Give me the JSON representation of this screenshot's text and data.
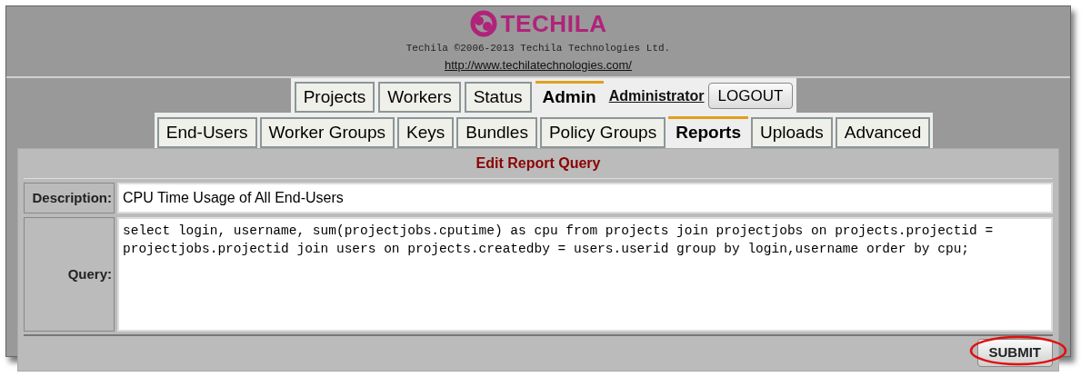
{
  "header": {
    "logo_text": "TECHILA",
    "copyright": "Techila ©2006-2013 Techila Technologies Ltd.",
    "link": "http://www.techilatechnologies.com/"
  },
  "main_tabs": [
    {
      "label": "Projects",
      "selected": false
    },
    {
      "label": "Workers",
      "selected": false
    },
    {
      "label": "Status",
      "selected": false
    },
    {
      "label": "Admin",
      "selected": true
    }
  ],
  "user": {
    "name": "Administrator",
    "logout": "LOGOUT"
  },
  "sub_tabs": [
    {
      "label": "End-Users",
      "selected": false
    },
    {
      "label": "Worker Groups",
      "selected": false
    },
    {
      "label": "Keys",
      "selected": false
    },
    {
      "label": "Bundles",
      "selected": false
    },
    {
      "label": "Policy Groups",
      "selected": false
    },
    {
      "label": "Reports",
      "selected": true
    },
    {
      "label": "Uploads",
      "selected": false
    },
    {
      "label": "Advanced",
      "selected": false
    }
  ],
  "form": {
    "title": "Edit Report Query",
    "description_label": "Description:",
    "description": "CPU Time Usage of All End-Users",
    "query_label": "Query:",
    "query": "select login, username, sum(projectjobs.cputime) as cpu from projects join projectjobs on projects.projectid = projectjobs.projectid join users on projects.createdby = users.userid group by login,username order by cpu;",
    "submit": "SUBMIT"
  }
}
